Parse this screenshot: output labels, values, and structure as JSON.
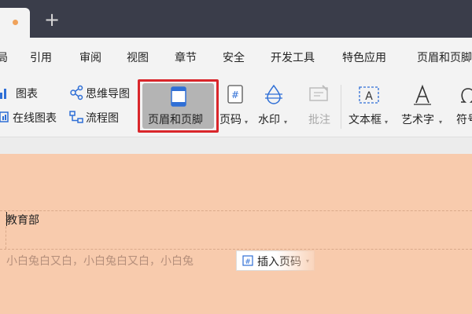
{
  "menu": {
    "items": [
      "局",
      "引用",
      "审阅",
      "视图",
      "章节",
      "安全",
      "开发工具",
      "特色应用",
      "页眉和页脚"
    ]
  },
  "ribbon": {
    "chart": "图表",
    "mindmap": "思维导图",
    "online_chart": "在线图表",
    "flowchart": "流程图",
    "header_footer": "页眉和页脚",
    "page_number": "页码",
    "watermark": "水印",
    "comment": "批注",
    "textbox": "文本框",
    "wordart": "艺术字",
    "symbol": "符号"
  },
  "document": {
    "header_text": "教育部",
    "body_text": "小白兔白又白，小白兔白又白，小白兔",
    "insert_page_number": "插入页码"
  },
  "colors": {
    "page_bg": "#f8cbad",
    "titlebar": "#3a3d4a",
    "highlight": "#d9262b",
    "accent_blue": "#2f6fd6"
  }
}
